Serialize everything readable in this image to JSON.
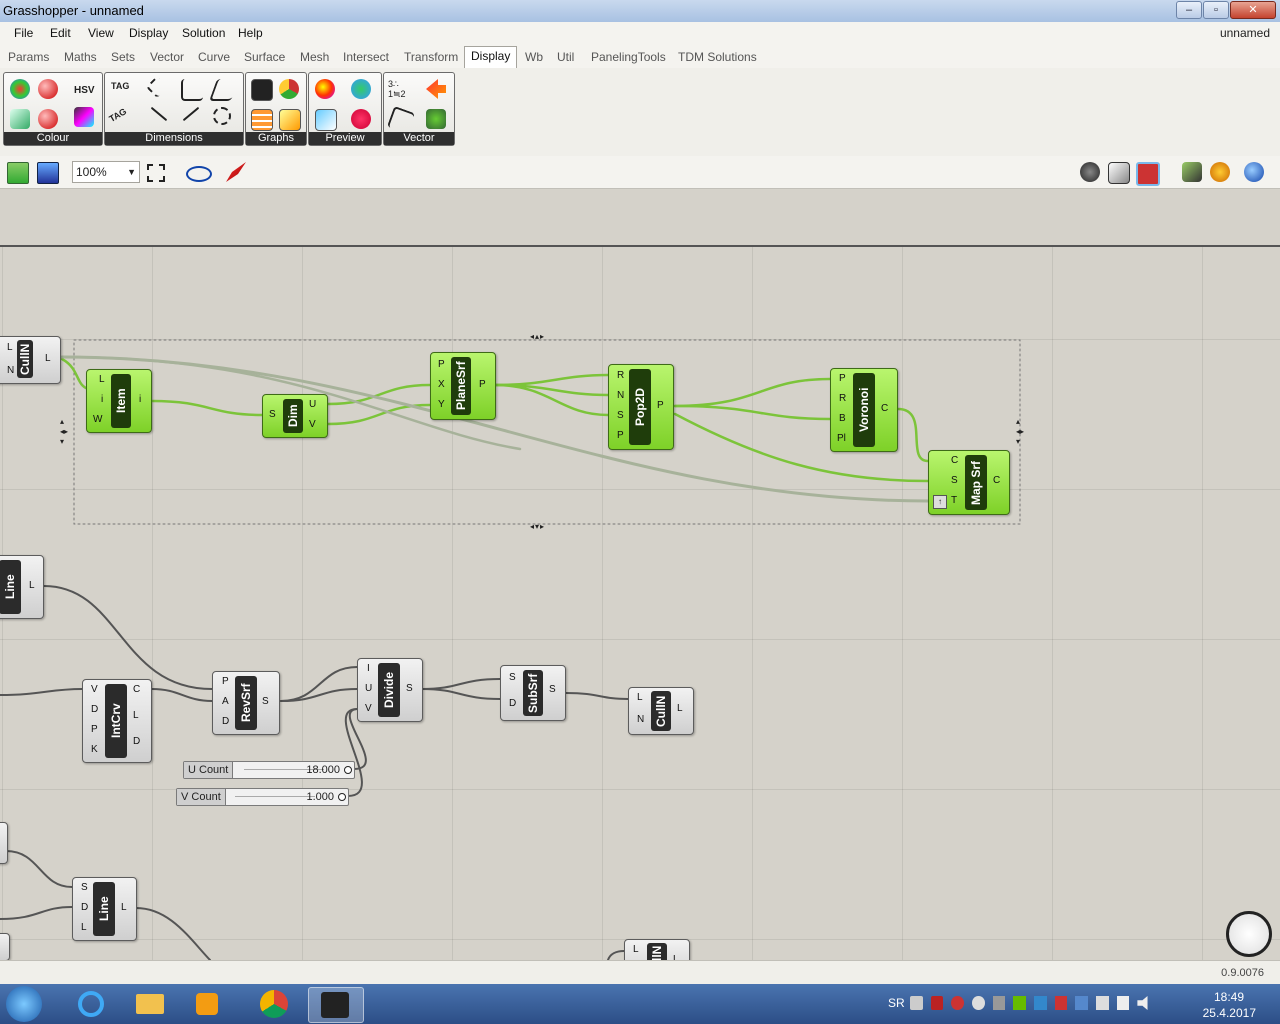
{
  "window": {
    "title": "Grasshopper - unnamed",
    "doc_name": "unnamed"
  },
  "menu": [
    "File",
    "Edit",
    "View",
    "Display",
    "Solution",
    "Help"
  ],
  "tabs": [
    "Params",
    "Maths",
    "Sets",
    "Vector",
    "Curve",
    "Surface",
    "Mesh",
    "Intersect",
    "Transform",
    "Display",
    "Wb",
    "Util",
    "PanelingTools",
    "TDM Solutions"
  ],
  "active_tab": "Display",
  "ribbon_panels": [
    "Colour",
    "Dimensions",
    "Graphs",
    "Preview",
    "Vector"
  ],
  "ribbon_icon_text": {
    "hsv": "HSV",
    "tag1": "TAG",
    "tag2": "TAG",
    "vec": "3∴\n1≒2"
  },
  "toolbar": {
    "zoom": "100%"
  },
  "components": {
    "culln_top": {
      "name": "CullN",
      "inputs": [
        "L",
        "N"
      ],
      "outputs": [
        "L"
      ]
    },
    "item": {
      "name": "Item",
      "inputs": [
        "L",
        "i",
        "W"
      ],
      "outputs": [
        "i"
      ]
    },
    "dim": {
      "name": "Dim",
      "inputs": [
        "S"
      ],
      "outputs": [
        "U",
        "V"
      ]
    },
    "planesrf": {
      "name": "PlaneSrf",
      "inputs": [
        "P",
        "X",
        "Y"
      ],
      "outputs": [
        "P"
      ]
    },
    "pop2d": {
      "name": "Pop2D",
      "inputs": [
        "R",
        "N",
        "S",
        "P"
      ],
      "outputs": [
        "P"
      ]
    },
    "voronoi": {
      "name": "Voronoi",
      "inputs": [
        "P",
        "R",
        "B",
        "Pl"
      ],
      "outputs": [
        "C"
      ]
    },
    "mapsrf": {
      "name": "Map Srf",
      "inputs": [
        "C",
        "S",
        "T"
      ],
      "outputs": [
        "C"
      ]
    },
    "line1": {
      "name": "Line",
      "inputs": [],
      "outputs": [
        "L"
      ]
    },
    "intcrv": {
      "name": "IntCrv",
      "inputs": [
        "V",
        "D",
        "P",
        "K"
      ],
      "outputs": [
        "C",
        "L",
        "D"
      ]
    },
    "revsrf": {
      "name": "RevSrf",
      "inputs": [
        "P",
        "A",
        "D"
      ],
      "outputs": [
        "S"
      ]
    },
    "divide": {
      "name": "Divide",
      "inputs": [
        "I",
        "U",
        "V"
      ],
      "outputs": [
        "S"
      ]
    },
    "subsrf": {
      "name": "SubSrf",
      "inputs": [
        "S",
        "D"
      ],
      "outputs": [
        "S"
      ]
    },
    "culln_mid": {
      "name": "CullN",
      "inputs": [
        "L",
        "N"
      ],
      "outputs": [
        "L"
      ]
    },
    "line2": {
      "name": "Line",
      "inputs": [
        "S",
        "D",
        "L"
      ],
      "outputs": [
        "L"
      ]
    },
    "culln_bottom": {
      "name": "CullN",
      "inputs": [
        "L"
      ],
      "outputs": [
        "L"
      ]
    }
  },
  "sliders": [
    {
      "label": "U Count",
      "value": "18.000"
    },
    {
      "label": "V Count",
      "value": "1.000"
    }
  ],
  "status": {
    "version": "0.9.0076"
  },
  "taskbar": {
    "lang": "SR",
    "time": "18:49",
    "date": "25.4.2017"
  }
}
